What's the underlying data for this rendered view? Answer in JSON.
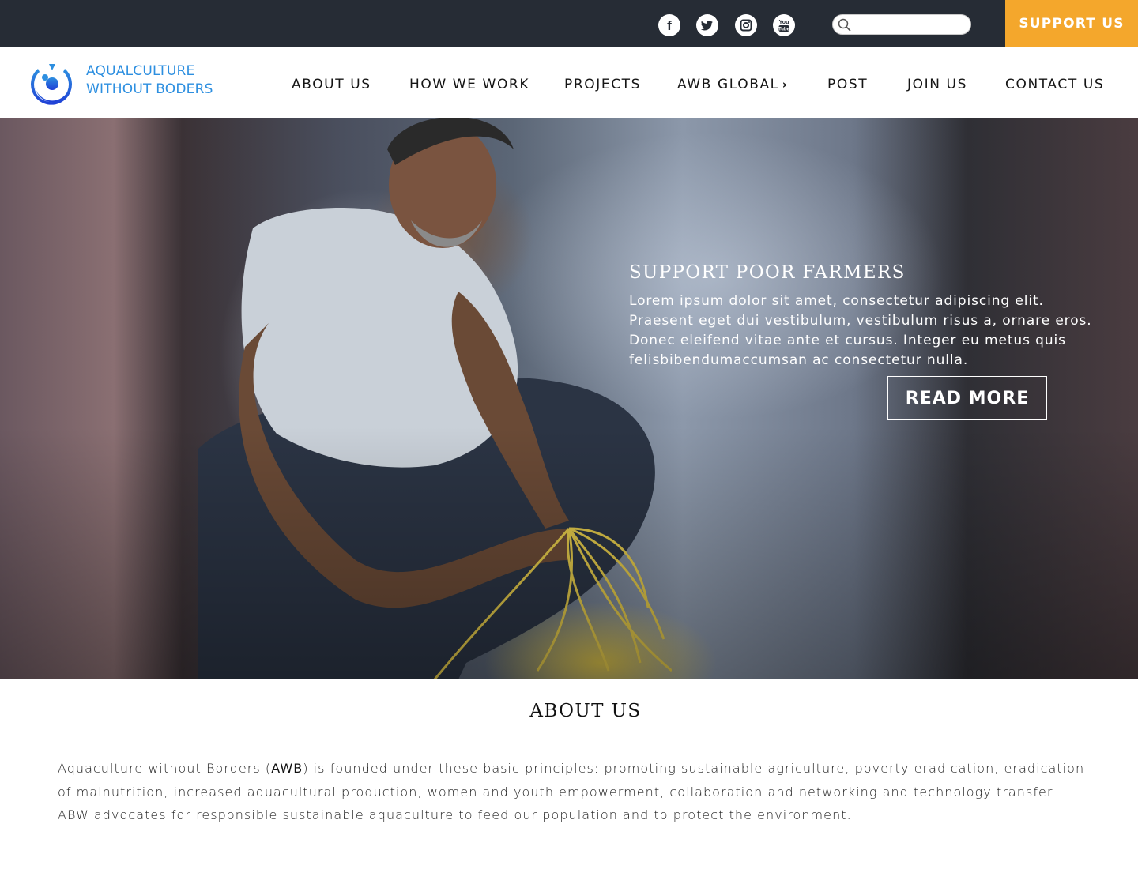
{
  "topbar": {
    "social": [
      {
        "name": "facebook-icon",
        "glyph": "f"
      },
      {
        "name": "twitter-icon",
        "glyph": "t"
      },
      {
        "name": "instagram-icon",
        "glyph": "ig"
      },
      {
        "name": "youtube-icon",
        "glyph": "You Tube"
      }
    ],
    "search": {
      "value": "",
      "placeholder": ""
    },
    "support_label": "SUPPORT US",
    "colors": {
      "background": "#262c35",
      "support": "#f4a72c"
    }
  },
  "header": {
    "brand_line1": "AQUALCULTURE",
    "brand_line2": "WITHOUT BODERS",
    "brand_color": "#2d8fe0",
    "nav": [
      "ABOUT US",
      "HOW WE WORK",
      "PROJECTS",
      "AWB GLOBAL",
      "POST",
      "JOIN US",
      "CONTACT US"
    ]
  },
  "hero": {
    "title": "SUPPORT POOR FARMERS",
    "text": "Lorem ipsum dolor sit amet, consectetur adipiscing elit. Praesent eget dui vestibulum, vestibulum risus a, ornare eros. Donec eleifend vitae ante et cursus. Integer eu metus quis felisbibendumaccumsan ac consectetur nulla.",
    "cta": "READ MORE"
  },
  "about": {
    "title": "ABOUT US",
    "text_before": "Aquaculture without Borders (",
    "text_bold": "AWB",
    "text_after": ") is founded under these basic principles: promoting sustainable agriculture, poverty eradication, eradication of malnutrition, increased aquacultural production, women and youth empowerment, collaboration and networking and technology transfer. ABW advocates for responsible sustainable aquaculture to feed our population and to protect the environment."
  }
}
